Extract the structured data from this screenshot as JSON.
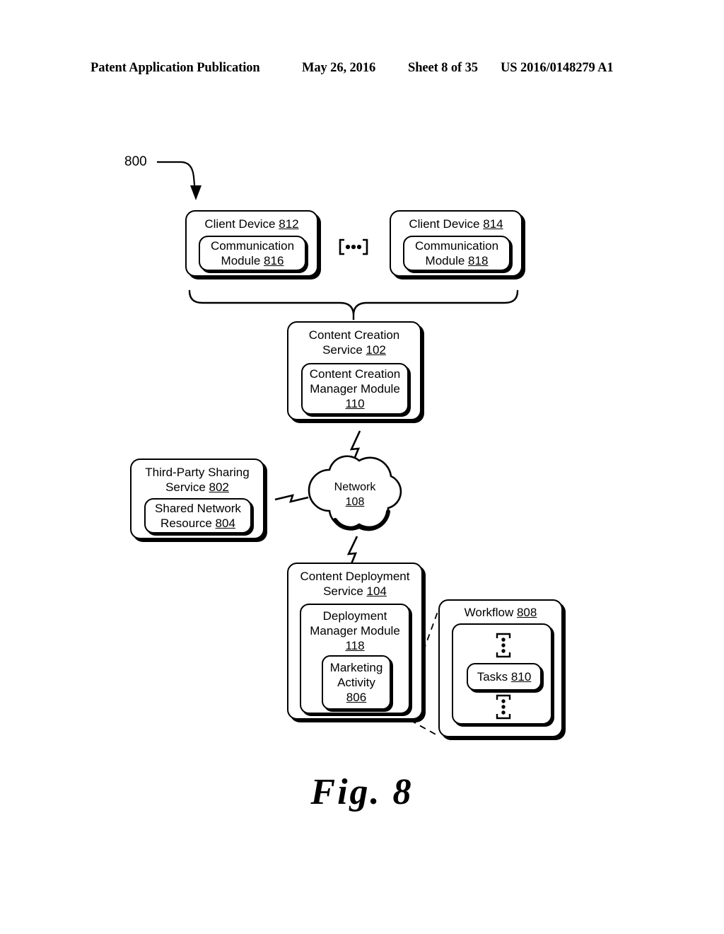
{
  "header": {
    "publication": "Patent Application Publication",
    "date": "May 26, 2016",
    "sheet": "Sheet 8 of 35",
    "patent_number": "US 2016/0148279 A1"
  },
  "figure": {
    "caption": "Fig. 8",
    "callout": "800",
    "ellipsis_horizontal": "(•••)",
    "ellipsis_vertical": "⋮"
  },
  "nodes": {
    "client_device_812": {
      "title_line1": "Client Device",
      "ref": "812",
      "child": {
        "line1": "Communication",
        "line2": "Module",
        "ref": "816"
      }
    },
    "client_device_814": {
      "title_line1": "Client Device",
      "ref": "814",
      "child": {
        "line1": "Communication",
        "line2": "Module",
        "ref": "818"
      }
    },
    "content_creation_service": {
      "line1": "Content Creation",
      "line2": "Service",
      "ref": "102",
      "child": {
        "line1": "Content Creation",
        "line2": "Manager Module",
        "ref": "110"
      }
    },
    "third_party_sharing_service": {
      "line1": "Third-Party Sharing",
      "line2": "Service",
      "ref": "802",
      "child": {
        "line1": "Shared Network",
        "line2": "Resource",
        "ref": "804"
      }
    },
    "network": {
      "line1": "Network",
      "ref": "108"
    },
    "content_deployment_service": {
      "line1": "Content Deployment",
      "line2": "Service",
      "ref": "104",
      "child": {
        "line1": "Deployment",
        "line2": "Manager Module",
        "ref": "118",
        "child": {
          "line1": "Marketing",
          "line2": "Activity",
          "ref": "806"
        }
      }
    },
    "workflow": {
      "line1": "Workflow",
      "ref": "808",
      "child": {
        "line1": "Tasks",
        "ref": "810"
      }
    }
  }
}
